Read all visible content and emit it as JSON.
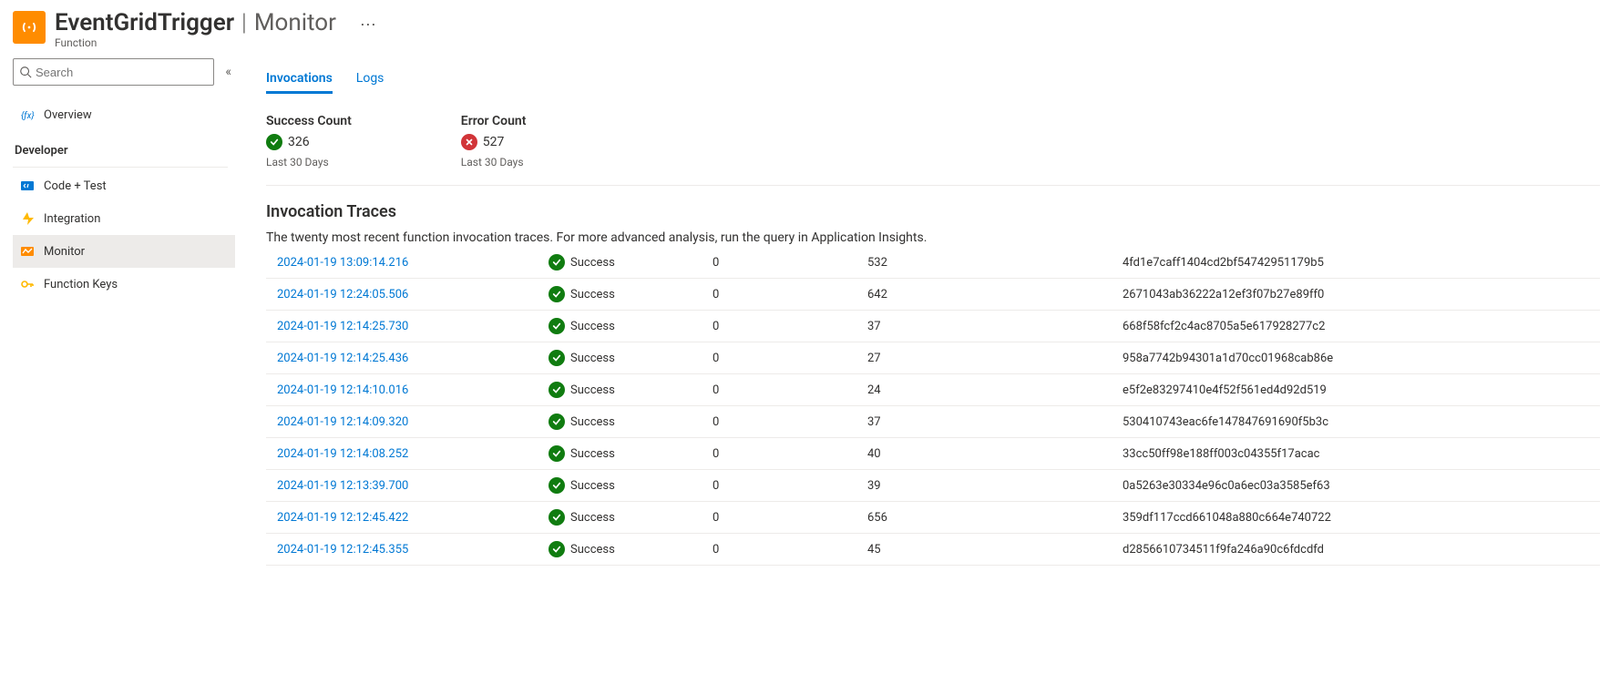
{
  "header": {
    "title_main": "EventGridTrigger",
    "title_suffix": "Monitor",
    "subtitle": "Function"
  },
  "sidebar": {
    "search_placeholder": "Search",
    "items": {
      "overview": "Overview"
    },
    "developer_label": "Developer",
    "developer_items": {
      "code_test": "Code + Test",
      "integration": "Integration",
      "monitor": "Monitor",
      "function_keys": "Function Keys"
    }
  },
  "tabs": {
    "invocations": "Invocations",
    "logs": "Logs"
  },
  "counters": {
    "success_label": "Success Count",
    "success_value": "326",
    "success_period": "Last 30 Days",
    "error_label": "Error Count",
    "error_value": "527",
    "error_period": "Last 30 Days"
  },
  "traces": {
    "heading": "Invocation Traces",
    "description": "The twenty most recent function invocation traces. For more advanced analysis, run the query in Application Insights.",
    "status_success": "Success",
    "rows": [
      {
        "ts": "2024-01-19 13:09:14.216",
        "status": "Success",
        "a": "0",
        "b": "532",
        "id": "4fd1e7caff1404cd2bf54742951179b5"
      },
      {
        "ts": "2024-01-19 12:24:05.506",
        "status": "Success",
        "a": "0",
        "b": "642",
        "id": "2671043ab36222a12ef3f07b27e89ff0"
      },
      {
        "ts": "2024-01-19 12:14:25.730",
        "status": "Success",
        "a": "0",
        "b": "37",
        "id": "668f58fcf2c4ac8705a5e617928277c2"
      },
      {
        "ts": "2024-01-19 12:14:25.436",
        "status": "Success",
        "a": "0",
        "b": "27",
        "id": "958a7742b94301a1d70cc01968cab86e"
      },
      {
        "ts": "2024-01-19 12:14:10.016",
        "status": "Success",
        "a": "0",
        "b": "24",
        "id": "e5f2e83297410e4f52f561ed4d92d519"
      },
      {
        "ts": "2024-01-19 12:14:09.320",
        "status": "Success",
        "a": "0",
        "b": "37",
        "id": "530410743eac6fe147847691690f5b3c"
      },
      {
        "ts": "2024-01-19 12:14:08.252",
        "status": "Success",
        "a": "0",
        "b": "40",
        "id": "33cc50ff98e188ff003c04355f17acac"
      },
      {
        "ts": "2024-01-19 12:13:39.700",
        "status": "Success",
        "a": "0",
        "b": "39",
        "id": "0a5263e30334e96c0a6ec03a3585ef63"
      },
      {
        "ts": "2024-01-19 12:12:45.422",
        "status": "Success",
        "a": "0",
        "b": "656",
        "id": "359df117ccd661048a880c664e740722"
      },
      {
        "ts": "2024-01-19 12:12:45.355",
        "status": "Success",
        "a": "0",
        "b": "45",
        "id": "d2856610734511f9fa246a90c6fdcdfd"
      }
    ]
  }
}
